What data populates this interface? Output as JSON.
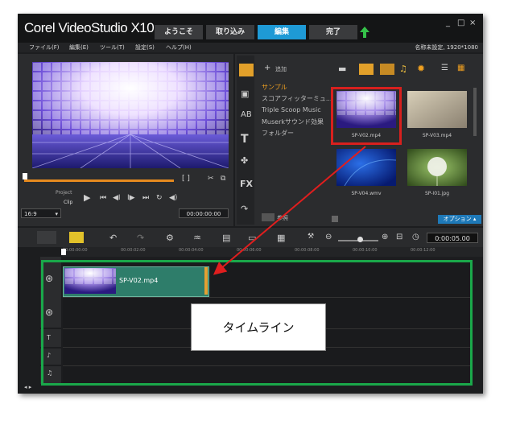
{
  "app": {
    "brand": "Corel VideoStudio X10",
    "window_controls": [
      "_",
      "□",
      "×"
    ]
  },
  "tabs": [
    "ようこそ",
    "取り込み",
    "編集",
    "完了"
  ],
  "active_tab": "編集",
  "menu": [
    "ファイル(F)",
    "編集(E)",
    "ツール(T)",
    "設定(S)",
    "ヘルプ(H)"
  ],
  "project_info": "名称未設定, 1920*1080",
  "player": {
    "project_label": "Project",
    "clip_label": "Clip",
    "aspect": "16:9",
    "timecode": "00:00:00:00",
    "trim_markers": "[ ]"
  },
  "library": {
    "add_label": "追加",
    "categories": [
      "サンプル",
      "スコアフィッターミュ...",
      "Triple Scoop Music",
      "Muserkサウンド効果",
      "フォルダー"
    ],
    "active_category": "サンプル",
    "browse_label": "参照",
    "options_label": "オプション",
    "thumbs": [
      {
        "name": "SP-V02.mp4"
      },
      {
        "name": "SP-V03.mp4"
      },
      {
        "name": "SP-V04.wmv"
      },
      {
        "name": "SP-I01.jpg"
      }
    ],
    "fx_label": "FX"
  },
  "timeline": {
    "duration": "0:00:05.00",
    "ruler_ticks": [
      "00:00:00:00",
      "00:00:02:00",
      "00:00:04:00",
      "00:00:06:00",
      "00:00:08:00",
      "00:00:10:00",
      "00:00:12:00"
    ],
    "clip_name": "SP-V02.mp4",
    "callout": "タイムライン"
  },
  "colors": {
    "accent": "#1e9ad6",
    "highlight_red": "#d8201e",
    "highlight_green": "#1aa84a",
    "clip": "#2e7d6a"
  }
}
